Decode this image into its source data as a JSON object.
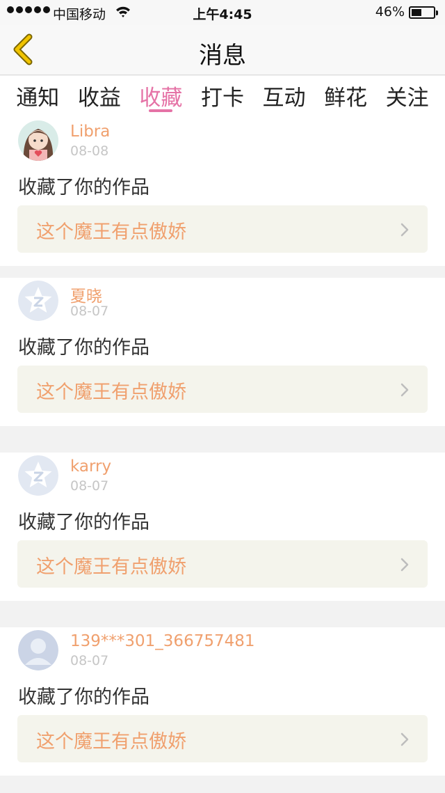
{
  "status_bar": {
    "carrier": "中国移动",
    "time": "上午4:45",
    "battery_percent": "46%",
    "battery_level": 0.46
  },
  "nav": {
    "title": "消息"
  },
  "tabs": [
    {
      "label": "通知",
      "active": false
    },
    {
      "label": "收益",
      "active": false
    },
    {
      "label": "收藏",
      "active": true
    },
    {
      "label": "打卡",
      "active": false
    },
    {
      "label": "互动",
      "active": false
    },
    {
      "label": "鲜花",
      "active": false
    },
    {
      "label": "关注",
      "active": false
    }
  ],
  "items": [
    {
      "username": "Libra",
      "date": "08-08",
      "action": "收藏了你的作品",
      "work_title": "这个魔王有点傲娇",
      "avatar": "girl-avatar"
    },
    {
      "username": "夏晓",
      "date": "08-07",
      "action": "收藏了你的作品",
      "work_title": "这个魔王有点傲娇",
      "avatar": "qzone-star-avatar"
    },
    {
      "username": "karry",
      "date": "08-07",
      "action": "收藏了你的作品",
      "work_title": "这个魔王有点傲娇",
      "avatar": "qzone-star-avatar"
    },
    {
      "username": "139***301_366757481",
      "date": "08-07",
      "action": "收藏了你的作品",
      "work_title": "这个魔王有点傲娇",
      "avatar": "default-person-avatar"
    }
  ],
  "colors": {
    "accent": "#e573a6",
    "username": "#f0a06e",
    "work_box_bg": "#f4f4ec",
    "back_arrow": "#f1c400"
  }
}
